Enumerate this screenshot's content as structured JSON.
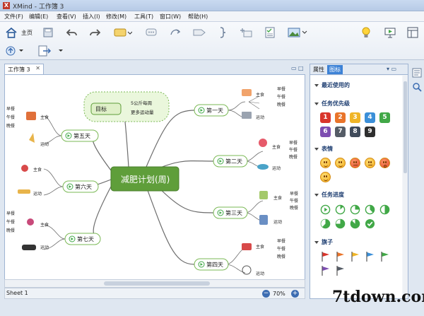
{
  "window": {
    "title": "XMind - 工作簿 3"
  },
  "menu": [
    "文件(F)",
    "编辑(E)",
    "查看(V)",
    "插入(I)",
    "修改(M)",
    "工具(T)",
    "窗口(W)",
    "帮助(H)"
  ],
  "toolbar": {
    "home_label": "主页",
    "icons": [
      "home-icon",
      "save-icon",
      "undo-icon",
      "redo-icon",
      "topic-icon",
      "callout-icon",
      "relationship-icon",
      "boundary-icon",
      "summary-icon",
      "subtopic-icon",
      "task-icon",
      "image-icon",
      "idea-icon",
      "present-icon",
      "share-icon",
      "export-icon"
    ]
  },
  "doc_tab": {
    "label": "工作簿 3"
  },
  "mindmap": {
    "central": "减肥计划(周)",
    "goal": {
      "label": "目标",
      "notes": [
        "5公斤每周",
        "更多运动量"
      ]
    },
    "branches": [
      {
        "label": "第一天",
        "meal": "主食",
        "sport": "运动",
        "times": [
          "早餐",
          "午餐",
          "晚餐"
        ]
      },
      {
        "label": "第二天",
        "meal": "主食",
        "sport": "运动",
        "times": [
          "早餐",
          "午餐",
          "晚餐"
        ]
      },
      {
        "label": "第三天",
        "meal": "主食",
        "sport": "运动",
        "times": [
          "早餐",
          "午餐",
          "晚餐"
        ]
      },
      {
        "label": "第四天",
        "meal": "主食",
        "sport": "运动",
        "times": [
          "早餐",
          "午餐",
          "晚餐"
        ]
      },
      {
        "label": "第五天",
        "meal": "主食",
        "sport": "运动",
        "times": [
          "早餐",
          "午餐",
          "晚餐"
        ]
      },
      {
        "label": "第六天",
        "meal": "主食",
        "sport": "运动",
        "times": []
      },
      {
        "label": "第七天",
        "meal": "主食",
        "sport": "运动",
        "times": [
          "早餐",
          "午餐",
          "晚餐"
        ]
      }
    ]
  },
  "status": {
    "sheet_tab": "Sheet 1",
    "zoom": "70%",
    "zoom_out": "−",
    "zoom_in": "+"
  },
  "right_panel": {
    "tabs": [
      "属性",
      "图标"
    ],
    "sections": {
      "recent": "最近使用的",
      "priority": "任务优先级",
      "emotion": "表情",
      "progress": "任务进度",
      "flags": "旗子"
    },
    "priority_numbers": [
      "1",
      "2",
      "3",
      "4",
      "5",
      "6",
      "7",
      "8",
      "9"
    ],
    "priority_colors": [
      "#d9352b",
      "#e9742a",
      "#f0b526",
      "#3b8fd8",
      "#41a847",
      "#7d4eb1",
      "#555c66",
      "#3f4a5a",
      "#2e2e2e"
    ],
    "flag_colors": [
      "#d9352b",
      "#e9742a",
      "#f0b526",
      "#3b8fd8",
      "#41a847",
      "#7d4eb1",
      "#555c66"
    ]
  },
  "watermark": "7tdown.com",
  "colors": {
    "central_fill": "#5f9e3a",
    "branch_border": "#7ab854",
    "goal_fill": "#e8f5d8"
  }
}
